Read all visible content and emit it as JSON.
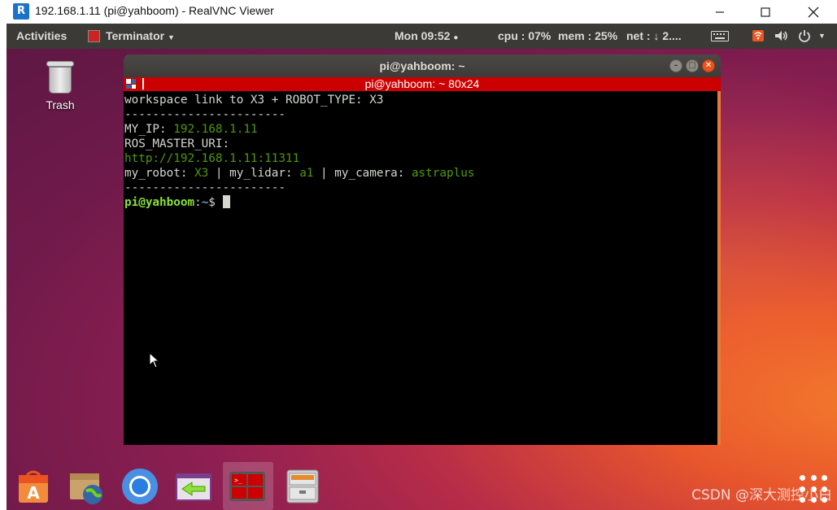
{
  "window": {
    "title": "192.168.1.11 (pi@yahboom) - RealVNC Viewer",
    "minimize_glyph": "—",
    "maximize_glyph": "☐",
    "close_glyph": "✕"
  },
  "top_panel": {
    "activities": "Activities",
    "app_menu": "Terminator",
    "clock": "Mon 09:52",
    "cpu": "cpu : 07%",
    "mem": "mem : 25%",
    "net": "net : ↓  2....",
    "status_icons": [
      "keyboard-icon",
      "network-icon",
      "volume-icon",
      "power-icon"
    ]
  },
  "desktop": {
    "trash_label": "Trash"
  },
  "terminal": {
    "window_title": "pi@yahboom: ~",
    "tab_title": "pi@yahboom: ~ 80x24",
    "lines": {
      "l1": "workspace link to X3 + ROBOT_TYPE: X3",
      "sep": "-----------------------",
      "ip_label": "MY_IP: ",
      "ip_value": "192.168.1.11",
      "ros_label": "ROS_MASTER_URI:",
      "ros_value": "http://192.168.1.11:11311",
      "robot_label": "my_robot: ",
      "robot_value": "X3",
      "lidar_label": " | my_lidar: ",
      "lidar_value": "a1",
      "camera_label": " | my_camera: ",
      "camera_value": "astraplus",
      "prompt_user": "pi@yahboom",
      "prompt_colon": ":",
      "prompt_path": "~",
      "prompt_dollar": "$ "
    }
  },
  "dock": {
    "items": [
      "software-center-icon",
      "network-files-icon",
      "chromium-icon",
      "remote-desktop-icon",
      "terminator-icon",
      "file-cabinet-icon"
    ],
    "active_item": "terminator-icon"
  },
  "watermark": "CSDN @深大测控小白",
  "colors": {
    "panel": "#3b3a36",
    "tab_bar": "#cc0000",
    "terminal_bg": "#000000",
    "prompt_green": "#8ae234",
    "value_green": "#4e9a06",
    "close_orange": "#e95420"
  }
}
